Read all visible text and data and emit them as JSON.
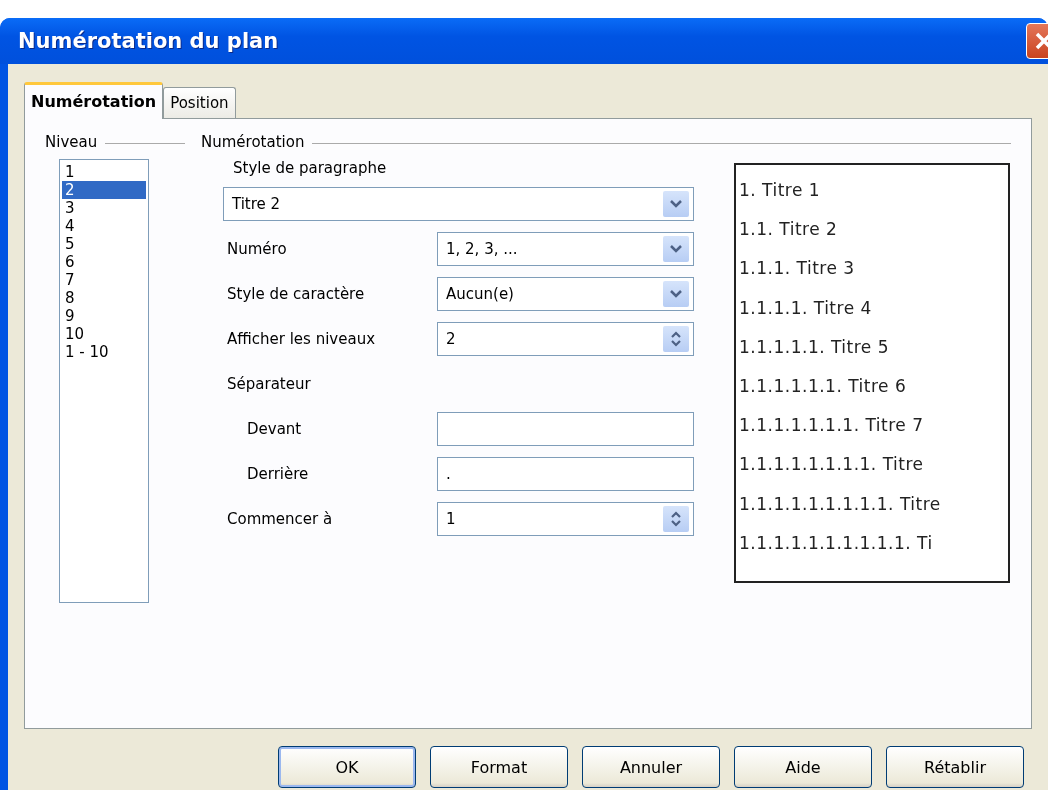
{
  "window": {
    "title": "Numérotation du plan"
  },
  "tabs": [
    {
      "label": "Numérotation",
      "selected": true
    },
    {
      "label": "Position",
      "selected": false
    }
  ],
  "level_group": {
    "title": "Niveau",
    "items": [
      {
        "label": "1",
        "selected": false
      },
      {
        "label": "2",
        "selected": true
      },
      {
        "label": "3",
        "selected": false
      },
      {
        "label": "4",
        "selected": false
      },
      {
        "label": "5",
        "selected": false
      },
      {
        "label": "6",
        "selected": false
      },
      {
        "label": "7",
        "selected": false
      },
      {
        "label": "8",
        "selected": false
      },
      {
        "label": "9",
        "selected": false
      },
      {
        "label": "10",
        "selected": false
      },
      {
        "label": "1 - 10",
        "selected": false
      }
    ]
  },
  "numbering_group": {
    "title": "Numérotation",
    "paragraph_style": {
      "label": "Style de paragraphe",
      "value": "Titre 2"
    },
    "fields": [
      {
        "kind": "dropdown",
        "label": "Numéro",
        "value": "1, 2, 3, ..."
      },
      {
        "kind": "dropdown",
        "label": "Style de caractère",
        "value": "Aucun(e)"
      },
      {
        "kind": "spin",
        "label": "Afficher les niveaux",
        "value": "2"
      },
      {
        "kind": "heading",
        "label": "Séparateur"
      },
      {
        "kind": "text",
        "label": "Devant"
      },
      {
        "kind": "text",
        "label": "Derrière",
        "value": "."
      },
      {
        "kind": "spin",
        "label": "Commencer à",
        "value": "1"
      }
    ]
  },
  "preview": [
    "1. Titre 1",
    "1.1. Titre 2",
    "1.1.1. Titre 3",
    "1.1.1.1. Titre 4",
    "1.1.1.1.1. Titre 5",
    "1.1.1.1.1.1. Titre 6",
    "1.1.1.1.1.1.1. Titre 7",
    "1.1.1.1.1.1.1.1. Titre",
    "1.1.1.1.1.1.1.1.1. Titre",
    "1.1.1.1.1.1.1.1.1.1. Ti"
  ],
  "buttons": [
    "OK",
    "Format",
    "Annuler",
    "Aide",
    "Rétablir"
  ]
}
